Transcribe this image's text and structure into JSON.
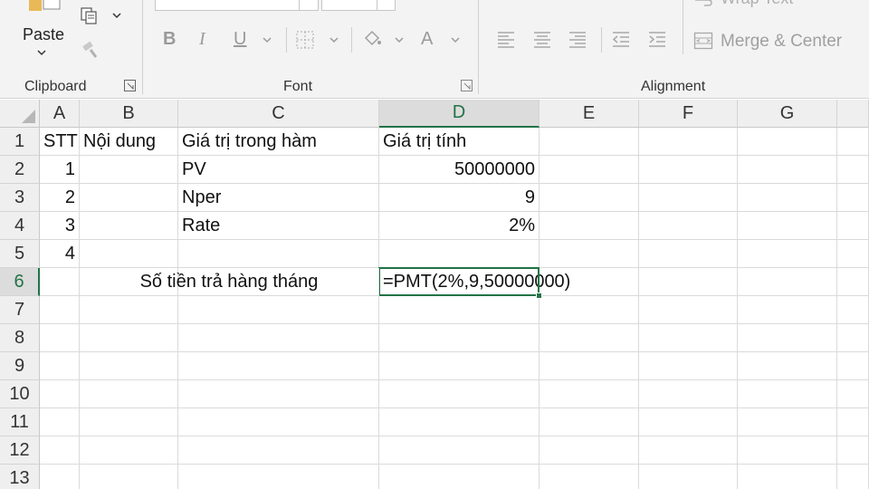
{
  "ribbon": {
    "clipboard": {
      "paste_label": "Paste",
      "group_label": "Clipboard"
    },
    "font": {
      "group_label": "Font",
      "bold": "B",
      "italic": "I",
      "underline": "U",
      "font_color": "A"
    },
    "alignment": {
      "group_label": "Alignment",
      "wrap_text": "Wrap Text",
      "merge_center": "Merge & Center"
    }
  },
  "sheet": {
    "columns": [
      "A",
      "B",
      "C",
      "D",
      "E",
      "F",
      "G"
    ],
    "rows": [
      "1",
      "2",
      "3",
      "4",
      "5",
      "6",
      "7",
      "8",
      "9",
      "10",
      "11",
      "12",
      "13"
    ],
    "active_cell": "D6",
    "cells": {
      "A1": "STT",
      "B1": "Nội dung",
      "C1": "Giá trị trong hàm",
      "D1": "Giá trị tính",
      "A2": "1",
      "C2": "PV",
      "D2": "50000000",
      "A3": "2",
      "C3": "Nper",
      "D3": "9",
      "A4": "3",
      "C4": "Rate",
      "D4": "2%",
      "A5": "4",
      "C6": "Số tiền trả hàng tháng",
      "D6": "=PMT(2%,9,50000000)"
    }
  },
  "colors": {
    "accent": "#217346",
    "ribbon_bg": "#f3f3f3",
    "header_bg": "#efefef"
  }
}
